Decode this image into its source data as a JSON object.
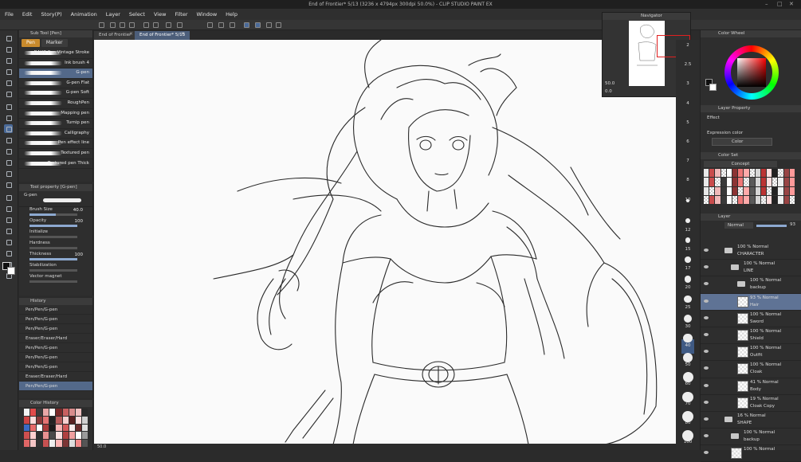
{
  "window": {
    "title": "End of Frontier* 5/13 (3236 x 4794px 300dpi 50.0%)  - CLIP STUDIO PAINT EX"
  },
  "menu": [
    "File",
    "Edit",
    "Story(P)",
    "Animation",
    "Layer",
    "Select",
    "View",
    "Filter",
    "Window",
    "Help"
  ],
  "document_tabs": [
    {
      "label": "End of Frontier",
      "active": false
    },
    {
      "label": "End of Frontier* 5/13",
      "active": true
    }
  ],
  "sub_tool": {
    "header": "Sub Tool [Pen]",
    "tabs": [
      {
        "label": "Pen",
        "active": true
      },
      {
        "label": "Marker",
        "active": false
      }
    ],
    "brushes": [
      {
        "label": "DAUB Pen Vintage Stroke",
        "selected": false
      },
      {
        "label": "Ink brush 4",
        "selected": false
      },
      {
        "label": "G-pen",
        "selected": true
      },
      {
        "label": "G-pen Flat",
        "selected": false
      },
      {
        "label": "G-pen Soft",
        "selected": false
      },
      {
        "label": "RoughPen",
        "selected": false
      },
      {
        "label": "Mapping pen",
        "selected": false
      },
      {
        "label": "Turnip pen",
        "selected": false
      },
      {
        "label": "Calligraphy",
        "selected": false
      },
      {
        "label": "Pen effect line",
        "selected": false
      },
      {
        "label": "Textured pen",
        "selected": false
      },
      {
        "label": "Textured pen Thick",
        "selected": false
      }
    ]
  },
  "tool_property": {
    "header": "Tool property [G-pen]",
    "tool_name": "G-pen",
    "props": [
      {
        "label": "Brush Size",
        "value": "40.0",
        "fill": 0.55
      },
      {
        "label": "Opacity",
        "value": "100",
        "fill": 1.0
      },
      {
        "label": "Initialize",
        "value": "",
        "fill": 0
      },
      {
        "label": "Hardness",
        "value": "",
        "fill": 0
      },
      {
        "label": "Thickness",
        "value": "100",
        "fill": 1.0
      },
      {
        "label": "Stabilization",
        "value": "",
        "fill": 0
      },
      {
        "label": "Vector magnet",
        "value": "",
        "fill": 0
      }
    ]
  },
  "history": {
    "header": "History",
    "items": [
      {
        "label": "Pen/Pen/G-pen",
        "selected": false
      },
      {
        "label": "Pen/Pen/G-pen",
        "selected": false
      },
      {
        "label": "Pen/Pen/G-pen",
        "selected": false
      },
      {
        "label": "Eraser/Eraser/Hard",
        "selected": false
      },
      {
        "label": "Pen/Pen/G-pen",
        "selected": false
      },
      {
        "label": "Pen/Pen/G-pen",
        "selected": false
      },
      {
        "label": "Pen/Pen/G-pen",
        "selected": false
      },
      {
        "label": "Eraser/Eraser/Hard",
        "selected": false
      },
      {
        "label": "Pen/Pen/G-pen",
        "selected": true
      }
    ]
  },
  "color_history": {
    "header": "Color History",
    "swatches": [
      "#f2f2f2",
      "#e14b4b",
      "#3b3b3b",
      "#e8a7a7",
      "#ffffff",
      "#7a2a2a",
      "#c86060",
      "#d98c8c",
      "#f0c0c0",
      "#2a2a2a",
      "#c44",
      "#ffdddd",
      "#8a3a3a",
      "#e57373",
      "#222",
      "#b85c5c",
      "#f7d0d0",
      "#5a2020",
      "#ffe0e0",
      "#d0d0d0",
      "#3a6ac4",
      "#e86a6a",
      "#ffffff",
      "#ab3a3a",
      "#1a1a1a",
      "#f4b4b4",
      "#d35a5a",
      "#fbeaea",
      "#6b2b2b",
      "#e0e0e0",
      "#cf4f4f",
      "#ffcfcf",
      "#2e2e2e",
      "#e99191",
      "#4a4a4a",
      "#f9e0e0",
      "#b04040",
      "#f0a0a0",
      "#ffffff",
      "#9a9a9a",
      "#e06666",
      "#f5c5c5",
      "#333333",
      "#c75151",
      "#eeeeee",
      "#ffb6b6",
      "#7d3535",
      "#dddddd",
      "#f38b8b",
      "#555555"
    ]
  },
  "status_bar": {
    "zoom": "50.0"
  },
  "navigator": {
    "header": "Navigator",
    "zoom": "50.0",
    "rotation": "0.0"
  },
  "ruler_ticks": [
    "2",
    "2.5",
    "3",
    "4",
    "5",
    "6",
    "7",
    "8",
    "10",
    "12",
    "15",
    "17",
    "20",
    "25",
    "30",
    "40",
    "50",
    "60",
    "70",
    "80",
    "100"
  ],
  "color_wheel": {
    "header": "Color Wheel",
    "main_color": "#101010",
    "sub_color": "#ffffff"
  },
  "layer_property": {
    "header": "Layer Property",
    "effect_label": "Effect",
    "expression_label": "Expression color",
    "expression_value": "Color"
  },
  "color_set": {
    "header": "Color Set",
    "set_name": "Concept"
  },
  "layer_panel": {
    "header": "Layer",
    "blend_mode": "Normal",
    "opacity": "93",
    "layers": [
      {
        "pct": "100 % Normal",
        "name": "CHARACTER",
        "kind": "folder",
        "indent": 0,
        "selected": false
      },
      {
        "pct": "100 % Normal",
        "name": "LINE",
        "kind": "folder",
        "indent": 1,
        "selected": false
      },
      {
        "pct": "100 % Normal",
        "name": "backup",
        "kind": "folder",
        "indent": 2,
        "selected": false
      },
      {
        "pct": "93 % Normal",
        "name": "Hair",
        "kind": "layer",
        "indent": 2,
        "selected": true
      },
      {
        "pct": "100 % Normal",
        "name": "Sword",
        "kind": "layer",
        "indent": 2,
        "selected": false
      },
      {
        "pct": "100 % Normal",
        "name": "Shield",
        "kind": "layer",
        "indent": 2,
        "selected": false
      },
      {
        "pct": "100 % Normal",
        "name": "Outfit",
        "kind": "layer",
        "indent": 2,
        "selected": false
      },
      {
        "pct": "100 % Normal",
        "name": "Cloak",
        "kind": "layer",
        "indent": 2,
        "selected": false
      },
      {
        "pct": "41 % Normal",
        "name": "Body",
        "kind": "layer",
        "indent": 2,
        "selected": false
      },
      {
        "pct": "19 % Normal",
        "name": "Cloak Copy",
        "kind": "layer",
        "indent": 2,
        "selected": false
      },
      {
        "pct": "16 % Normal",
        "name": "SHAPE",
        "kind": "folder",
        "indent": 0,
        "selected": false
      },
      {
        "pct": "100 % Normal",
        "name": "backup",
        "kind": "folder",
        "indent": 1,
        "selected": false
      },
      {
        "pct": "100 % Normal",
        "name": "",
        "kind": "layer",
        "indent": 1,
        "selected": false
      }
    ]
  },
  "colors": {
    "accent": "#53698a",
    "tab_active": "#c88a2c",
    "nav_frame": "#e02020"
  }
}
